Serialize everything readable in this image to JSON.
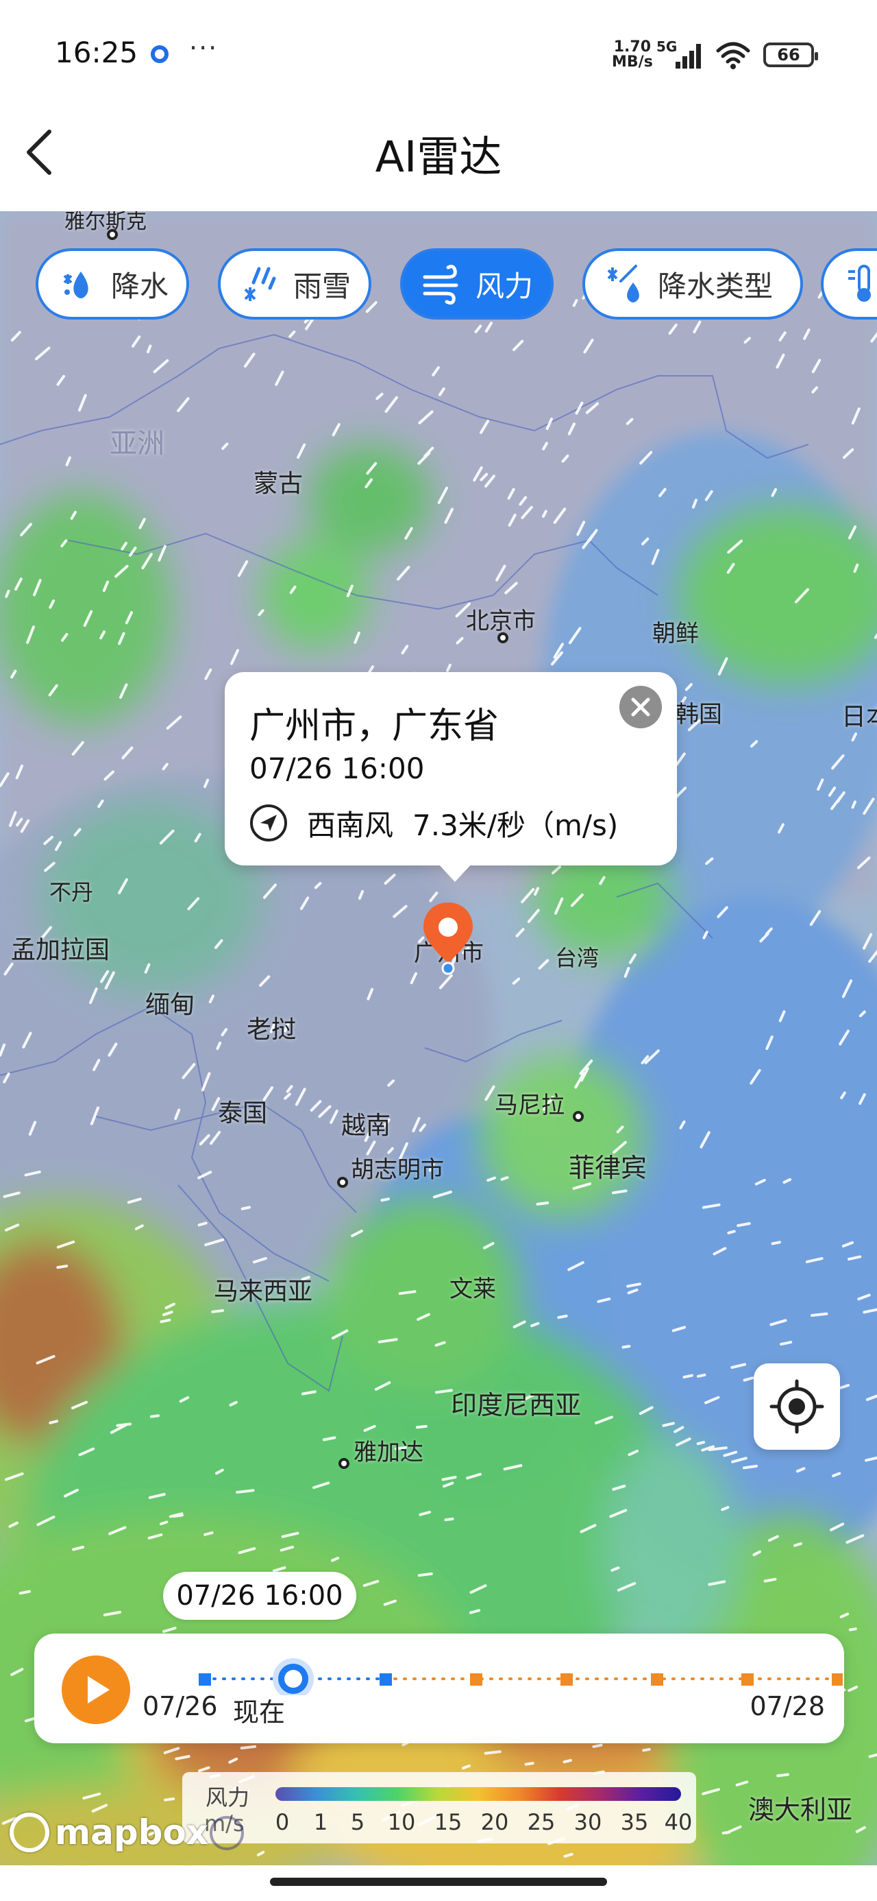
{
  "status_bar": {
    "time": "16:25",
    "more": "···",
    "net_speed_value": "1.70",
    "net_speed_unit": "MB/s",
    "network": "5G",
    "battery": "66"
  },
  "header": {
    "title": "AI雷达",
    "back_icon": "chevron-left-icon"
  },
  "layer_tabs": [
    {
      "label": "降水",
      "icon": "precipitation-icon",
      "active": false
    },
    {
      "label": "雨雪",
      "icon": "rain-snow-icon",
      "active": false
    },
    {
      "label": "风力",
      "icon": "wind-icon",
      "active": true
    },
    {
      "label": "降水类型",
      "icon": "precipitation-type-icon",
      "active": false
    },
    {
      "label": "",
      "icon": "temperature-icon",
      "active": false
    }
  ],
  "map_labels": {
    "yarkand_partial": "雅尔斯克",
    "asia": "亚洲",
    "mongolia": "蒙古",
    "beijing": "北京市",
    "north_korea": "朝鲜",
    "south_korea": "韩国",
    "japan_partial": "日本",
    "bhutan": "不丹",
    "bangladesh": "孟加拉国",
    "myanmar": "缅甸",
    "laos": "老挝",
    "guangzhou": "广州市",
    "taiwan": "台湾",
    "thailand": "泰国",
    "vietnam": "越南",
    "manila": "马尼拉",
    "hcmc": "胡志明市",
    "philippines": "菲律宾",
    "malaysia": "马来西亚",
    "brunei": "文莱",
    "indonesia": "印度尼西亚",
    "jakarta": "雅加达",
    "australia": "澳大利亚"
  },
  "popup": {
    "title": "广州市，广东省",
    "time": "07/26 16:00",
    "wind_direction": "西南风",
    "wind_speed": "7.3米/秒（m/s)",
    "close_icon": "close-icon",
    "direction_icon": "navigation-arrow-icon"
  },
  "timeline": {
    "current_chip": "07/26 16:00",
    "start_label": "07/26",
    "now_label": "现在",
    "end_label": "07/28",
    "play_icon": "play-icon"
  },
  "legend": {
    "title": "风力",
    "unit": "m/s",
    "ticks": [
      "0",
      "1",
      "5",
      "10",
      "15",
      "20",
      "25",
      "30",
      "35",
      "40"
    ]
  },
  "attribution": {
    "logo": "mapbox",
    "info_icon": "info-icon"
  },
  "locate_icon": "locate-icon"
}
